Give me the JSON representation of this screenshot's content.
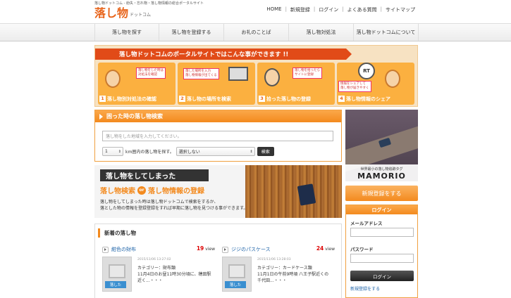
{
  "header": {
    "tagline": "落し物ドットコム - 紛失・忘れ物・落し物情報の総合ポータルサイト",
    "logo_main": "落し物",
    "logo_sub": "ドットコム"
  },
  "top_nav": [
    {
      "label": "HOME"
    },
    {
      "label": "新規登録"
    },
    {
      "label": "ログイン"
    },
    {
      "label": "よくある質問"
    },
    {
      "label": "サイトマップ"
    }
  ],
  "main_nav": [
    {
      "label": "落し物を探す"
    },
    {
      "label": "落し物を登録する"
    },
    {
      "label": "お礼のことば"
    },
    {
      "label": "落し物対処法"
    },
    {
      "label": "落し物ドットコムについて"
    }
  ],
  "banner": {
    "ribbon": "落し物ドットコムのポータルサイトではこんな事ができます !!",
    "steps": [
      {
        "num": "1",
        "caption": "落し物別対処法の確認",
        "bubble": "落し物をした時は\n対処法を確認"
      },
      {
        "num": "2",
        "caption": "落し物の場所を検索",
        "bubble": "落した場所を入力\n落し物情報が出てくる"
      },
      {
        "num": "3",
        "caption": "拾った落し物の登録",
        "bubble": "落し物を拾ったら\nサイトに登録"
      },
      {
        "num": "4",
        "caption": "落し物情報のシェア",
        "bubble": "情報をシェアして\n落し物が届きやすく",
        "badge": "RT"
      }
    ]
  },
  "search": {
    "title": "困った時の落し物検索",
    "placeholder": "落し物をした地域を入力してください。",
    "radius_value": "1",
    "radius_label": "km圏内の落し物を探す。",
    "category_value": "選択しない",
    "button_label": "検索"
  },
  "feature": {
    "headline": "落し物をしてしまった",
    "sub_left": "落し物検索",
    "or": "or",
    "sub_right": "落し物情報の登録",
    "desc_line1": "落し物をしてしまった時は落し物ドットコムで検索をするか、",
    "desc_line2": "落とした物の情報を登録登録をすれば早期に落し物を見つける事ができます。"
  },
  "new_items": {
    "title": "新着の落し物",
    "view_unit": "view",
    "items": [
      {
        "name": "紺色の財布",
        "views": "19",
        "date": "2015/11/06 13:27:02",
        "category": "カテゴリー：財布類",
        "desc_line1": "11月4日のお昼11時30分頃に、穂田駅",
        "desc_line2": "近く...・・・",
        "tag": "落した"
      },
      {
        "name": "ジジのパスケース",
        "views": "24",
        "date": "2015/11/06 13:28:03",
        "category": "カテゴリー：カードケース類",
        "desc_line1": "11月1日の午前9時頃 八王子駅近くの",
        "desc_line2": "千代田...・・・",
        "tag": "落した"
      }
    ]
  },
  "sidebar": {
    "ad_small": "世界最小の落し物追跡タグ",
    "ad_big": "MAMORIO",
    "register_button": "新規登録をする",
    "login": {
      "title": "ログイン",
      "email_label": "メールアドレス",
      "password_label": "パスワード",
      "button_label": "ログイン",
      "register_link": "新規登録をする"
    }
  },
  "colors": {
    "accent": "#f38a1e",
    "ribbon": "#e14b18",
    "link": "#2266aa"
  }
}
